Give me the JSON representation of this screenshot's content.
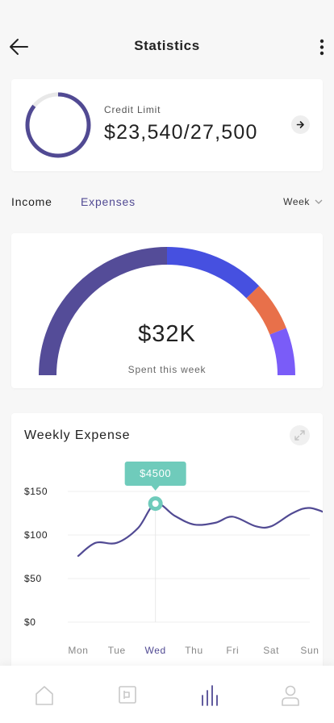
{
  "header": {
    "title": "Statistics",
    "back_icon": "arrow-left-icon",
    "more_icon": "more-vertical-icon"
  },
  "credit": {
    "label": "Credit Limit",
    "value": "$23,540/27,500",
    "used_fraction": 0.856,
    "arrow_icon": "arrow-right-icon"
  },
  "tabs": {
    "income": "Income",
    "expenses": "Expenses",
    "active": "Expenses",
    "period": "Week",
    "period_icon": "chevron-down-icon"
  },
  "gauge": {
    "value": "$32K",
    "caption": "Spent this week",
    "segments": [
      {
        "fraction": 0.5,
        "color": "#544c98"
      },
      {
        "fraction": 0.255,
        "color": "#4650e0"
      },
      {
        "fraction": 0.125,
        "color": "#e8704a"
      },
      {
        "fraction": 0.12,
        "color": "#7a5cf8"
      }
    ]
  },
  "weekly": {
    "title": "Weekly Expense",
    "expand_icon": "expand-icon",
    "tooltip": "$4500",
    "selected_day": "Wed"
  },
  "colors": {
    "accent": "#514a93",
    "tooltip": "#6fcbbb",
    "line": "#514a93"
  },
  "nav": [
    {
      "name": "home",
      "icon": "home-icon"
    },
    {
      "name": "wallet",
      "icon": "wallet-icon"
    },
    {
      "name": "statistics",
      "icon": "bar-chart-icon",
      "active": true
    },
    {
      "name": "profile",
      "icon": "user-icon"
    }
  ],
  "chart_data": {
    "type": "line",
    "title": "Weekly Expense",
    "categories": [
      "Mon",
      "Tue",
      "Wed",
      "Thu",
      "Fri",
      "Sat",
      "Sun"
    ],
    "y_ticks": [
      "$150",
      "$100",
      "$50",
      "$0"
    ],
    "y_tick_values": [
      150,
      100,
      50,
      0
    ],
    "ylim": [
      0,
      150
    ],
    "grid": true,
    "series": [
      {
        "x": [
          0,
          0.45,
          1,
          1.55,
          2,
          2.5,
          3,
          3.55,
          4,
          4.6,
          5,
          5.55,
          6,
          6.6
        ],
        "values": [
          76,
          91,
          91,
          108,
          136,
          122,
          112,
          114,
          121,
          110,
          110,
          125,
          131,
          122
        ]
      }
    ],
    "highlight": {
      "x": 2,
      "value": 136,
      "label": "$4500"
    }
  }
}
